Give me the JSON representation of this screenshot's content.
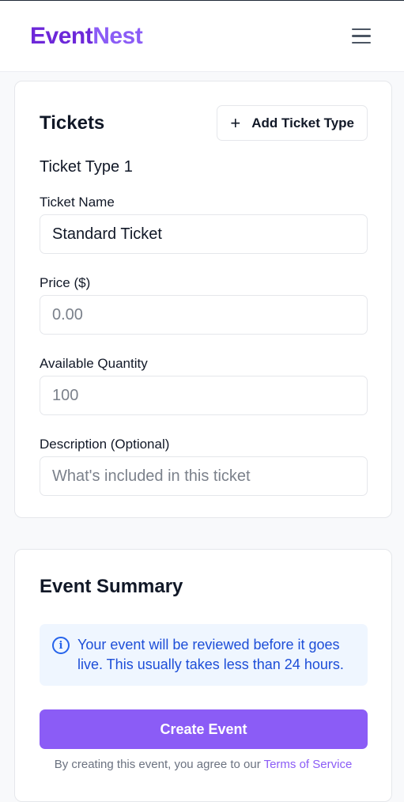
{
  "app": {
    "logo_part1": "Event",
    "logo_part2": "Nest",
    "menu_icon": "hamburger-menu-icon"
  },
  "tickets": {
    "title": "Tickets",
    "add_button_label": "Add Ticket Type",
    "add_icon": "plus-icon",
    "ticket_type_title": "Ticket Type 1",
    "fields": {
      "name": {
        "label": "Ticket Name",
        "value": "Standard Ticket",
        "placeholder": ""
      },
      "price": {
        "label": "Price ($)",
        "value": "",
        "placeholder": "0.00"
      },
      "quantity": {
        "label": "Available Quantity",
        "value": "",
        "placeholder": "100"
      },
      "description": {
        "label": "Description (Optional)",
        "value": "",
        "placeholder": "What's included in this ticket"
      }
    }
  },
  "summary": {
    "title": "Event Summary",
    "info_icon": "info-icon",
    "info_text": "Your event will be reviewed before it goes live. This usually takes less than 24 hours.",
    "create_button_label": "Create Event",
    "terms_prefix": "By creating this event, you agree to our ",
    "terms_link": "Terms of Service"
  },
  "colors": {
    "brand": "#6d28d9",
    "brand_light": "#8b5cf6",
    "info_bg": "#eff6ff",
    "info_text": "#1d4ed8"
  }
}
